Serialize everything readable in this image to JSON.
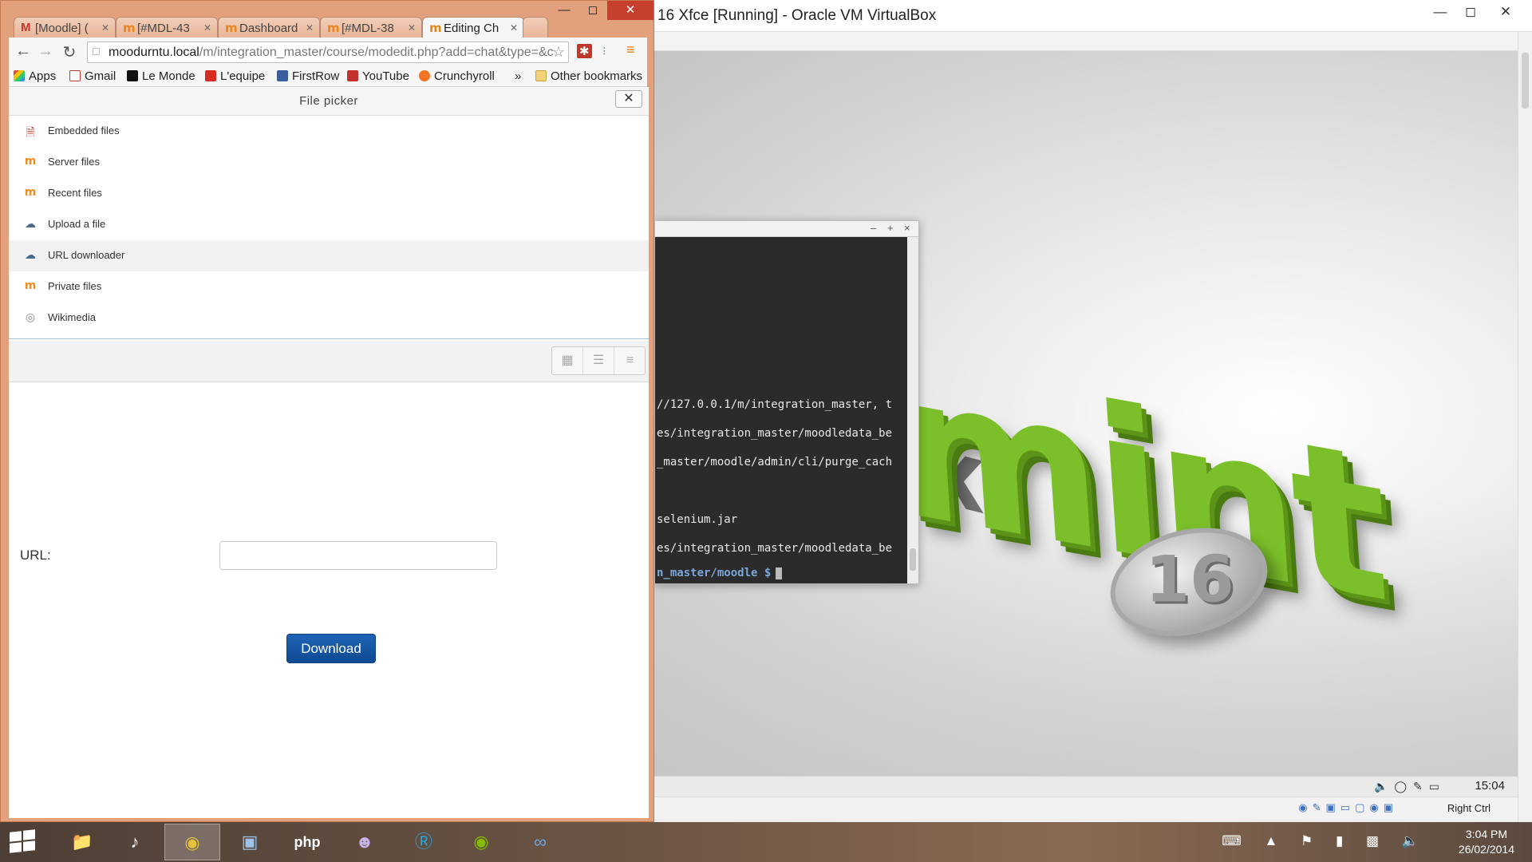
{
  "vbox": {
    "title": "16 Xfce [Running] - Oracle VM VirtualBox",
    "terminal_lines": [
      "//127.0.0.1/m/integration_master, t",
      "es/integration_master/moodledata_be",
      "_master/moodle/admin/cli/purge_cach",
      "",
      "selenium.jar",
      "es/integration_master/moodledata_be"
    ],
    "terminal_prompt": "n_master/moodle $",
    "guest_clock": "15:04",
    "host_key": "Right Ctrl"
  },
  "chrome": {
    "tabs": [
      {
        "label": "[Moodle] (",
        "icon": "gmail-icon"
      },
      {
        "label": "[#MDL-43",
        "icon": "moodle-icon"
      },
      {
        "label": "Dashboard",
        "icon": "moodle-icon"
      },
      {
        "label": "[#MDL-38",
        "icon": "moodle-icon"
      },
      {
        "label": "Editing Ch",
        "icon": "moodle-icon"
      }
    ],
    "url_host": "moodurntu.local",
    "url_path": "/m/integration_master/course/modedit.php?add=chat&type=&c",
    "bookmarks": [
      "Apps",
      "Gmail",
      "Le Monde",
      "L'equipe",
      "FirstRow",
      "YouTube",
      "Crunchyroll",
      "»",
      "Other bookmarks"
    ]
  },
  "filepicker": {
    "title": "File picker",
    "repositories": [
      {
        "label": "Embedded files",
        "icon": "document-icon"
      },
      {
        "label": "Server files",
        "icon": "moodle-icon"
      },
      {
        "label": "Recent files",
        "icon": "moodle-icon"
      },
      {
        "label": "Upload a file",
        "icon": "upload-icon"
      },
      {
        "label": "URL downloader",
        "icon": "url-icon"
      },
      {
        "label": "Private files",
        "icon": "moodle-icon"
      },
      {
        "label": "Wikimedia",
        "icon": "wikimedia-icon"
      }
    ],
    "selected_repository": "URL downloader",
    "url_label": "URL:",
    "url_value": "",
    "download_label": "Download"
  },
  "taskbar": {
    "time": "3:04 PM",
    "date": "26/02/2014"
  },
  "colors": {
    "chrome_frame": "#e3a07d",
    "close_button": "#c7402f",
    "download_button": "#1a5aa8",
    "moodle_orange": "#f08c1f",
    "mint_green": "#7bbf2a"
  }
}
